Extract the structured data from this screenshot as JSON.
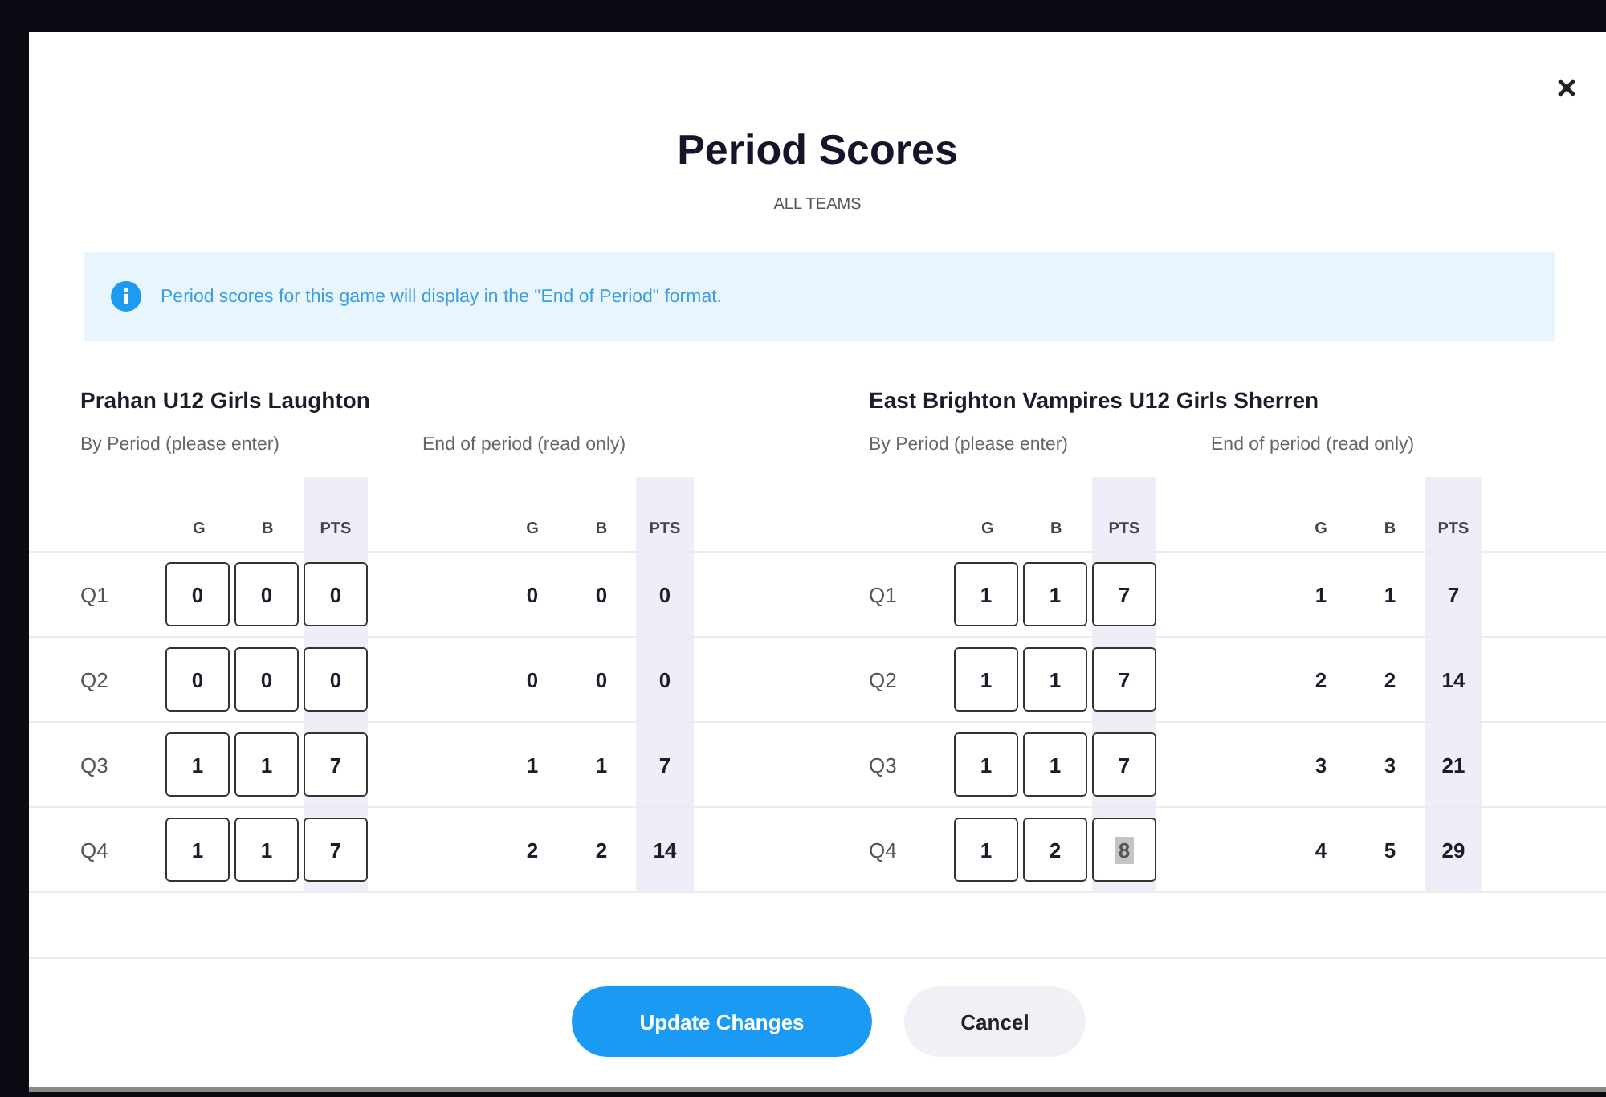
{
  "dialog": {
    "title": "Period Scores",
    "subtitle": "ALL TEAMS",
    "close": "×"
  },
  "info": {
    "text": "Period scores for this game will display in the \"End of Period\" format."
  },
  "teams": [
    {
      "name": "Prahan U12 Girls Laughton",
      "entry_label": "By Period (please enter)",
      "readonly_label": "End of period (read only)",
      "entry_columns": [
        "G",
        "B",
        "PTS"
      ],
      "readonly_columns": [
        "G",
        "B",
        "PTS"
      ],
      "periods": [
        {
          "label": "Q1",
          "entry": [
            {
              "value": "0",
              "highlighted": false
            },
            {
              "value": "0",
              "highlighted": false
            },
            {
              "value": "0",
              "highlighted": false
            }
          ],
          "totals": [
            "0",
            "0",
            "0"
          ]
        },
        {
          "label": "Q2",
          "entry": [
            {
              "value": "0",
              "highlighted": false
            },
            {
              "value": "0",
              "highlighted": false
            },
            {
              "value": "0",
              "highlighted": false
            }
          ],
          "totals": [
            "0",
            "0",
            "0"
          ]
        },
        {
          "label": "Q3",
          "entry": [
            {
              "value": "1",
              "highlighted": false
            },
            {
              "value": "1",
              "highlighted": false
            },
            {
              "value": "7",
              "highlighted": false
            }
          ],
          "totals": [
            "1",
            "1",
            "7"
          ]
        },
        {
          "label": "Q4",
          "entry": [
            {
              "value": "1",
              "highlighted": false
            },
            {
              "value": "1",
              "highlighted": false
            },
            {
              "value": "7",
              "highlighted": false
            }
          ],
          "totals": [
            "2",
            "2",
            "14"
          ]
        }
      ]
    },
    {
      "name": "East Brighton Vampires U12 Girls Sherren",
      "entry_label": "By Period (please enter)",
      "readonly_label": "End of period (read only)",
      "entry_columns": [
        "G",
        "B",
        "PTS"
      ],
      "readonly_columns": [
        "G",
        "B",
        "PTS"
      ],
      "periods": [
        {
          "label": "Q1",
          "entry": [
            {
              "value": "1",
              "highlighted": false
            },
            {
              "value": "1",
              "highlighted": false
            },
            {
              "value": "7",
              "highlighted": false
            }
          ],
          "totals": [
            "1",
            "1",
            "7"
          ]
        },
        {
          "label": "Q2",
          "entry": [
            {
              "value": "1",
              "highlighted": false
            },
            {
              "value": "1",
              "highlighted": false
            },
            {
              "value": "7",
              "highlighted": false
            }
          ],
          "totals": [
            "2",
            "2",
            "14"
          ]
        },
        {
          "label": "Q3",
          "entry": [
            {
              "value": "1",
              "highlighted": false
            },
            {
              "value": "1",
              "highlighted": false
            },
            {
              "value": "7",
              "highlighted": false
            }
          ],
          "totals": [
            "3",
            "3",
            "21"
          ]
        },
        {
          "label": "Q4",
          "entry": [
            {
              "value": "1",
              "highlighted": false
            },
            {
              "value": "2",
              "highlighted": false
            },
            {
              "value": "8",
              "highlighted": true
            }
          ],
          "totals": [
            "4",
            "5",
            "29"
          ]
        }
      ]
    }
  ],
  "buttons": [
    {
      "label": "Update Changes",
      "kind": "primary"
    },
    {
      "label": "Cancel",
      "kind": "secondary"
    }
  ]
}
